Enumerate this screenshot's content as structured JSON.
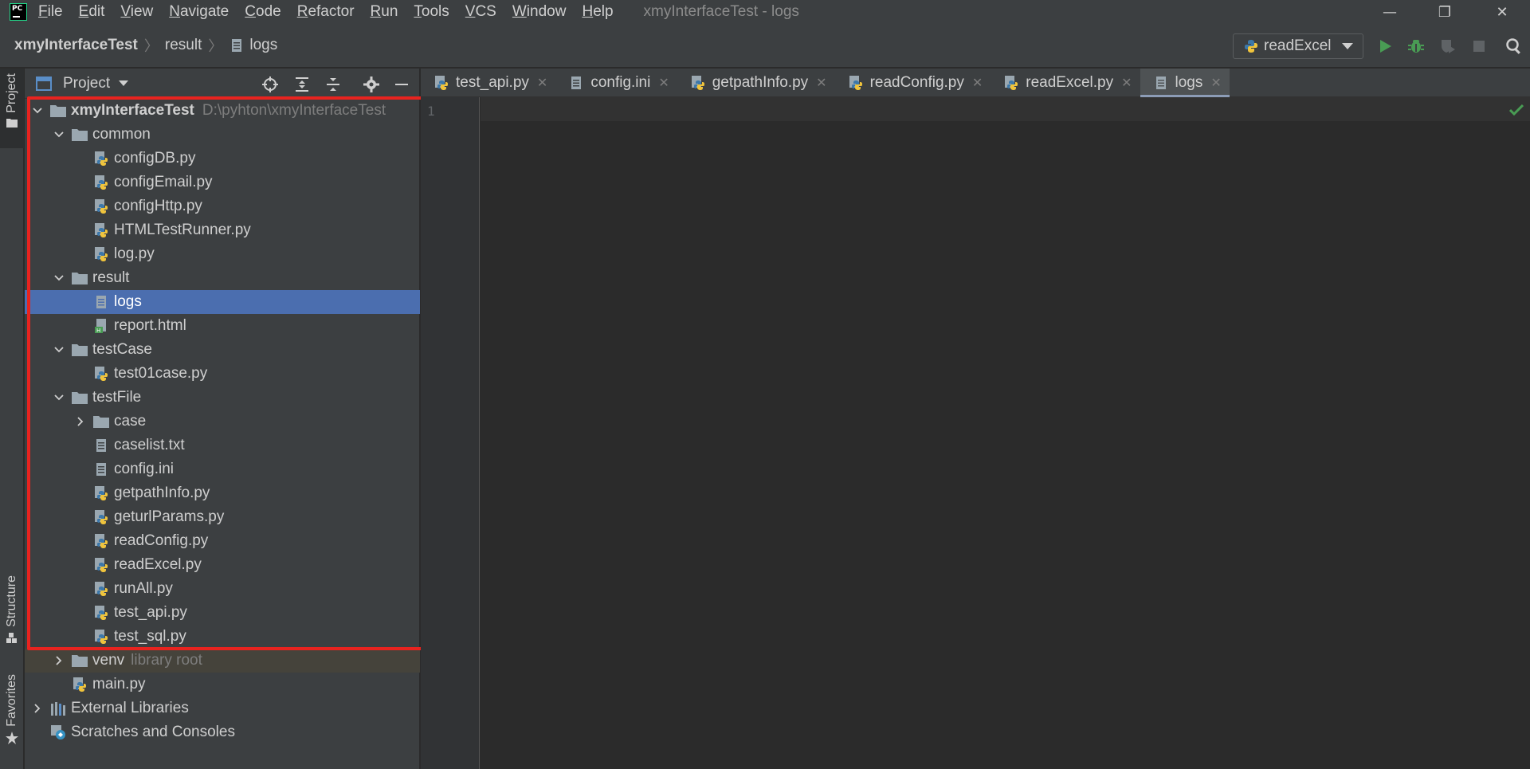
{
  "app": {
    "logo_text": "PC",
    "window_title": "xmyInterfaceTest - logs",
    "window_controls": {
      "minimize": "—",
      "maximize": "❐",
      "close": "✕"
    }
  },
  "menu": [
    "File",
    "Edit",
    "View",
    "Navigate",
    "Code",
    "Refactor",
    "Run",
    "Tools",
    "VCS",
    "Window",
    "Help"
  ],
  "breadcrumb": [
    "xmyInterfaceTest",
    "result",
    "logs"
  ],
  "run_config": {
    "label": "readExcel"
  },
  "left_strip": {
    "project": "Project",
    "structure": "Structure",
    "favorites": "Favorites"
  },
  "project_panel": {
    "title": "Project",
    "tree": [
      {
        "label": "xmyInterfaceTest",
        "hint": "D:\\pyhton\\xmyInterfaceTest"
      },
      {
        "label": "common"
      },
      {
        "label": "configDB.py"
      },
      {
        "label": "configEmail.py"
      },
      {
        "label": "configHttp.py"
      },
      {
        "label": "HTMLTestRunner.py"
      },
      {
        "label": "log.py"
      },
      {
        "label": "result"
      },
      {
        "label": "logs"
      },
      {
        "label": "report.html"
      },
      {
        "label": "testCase"
      },
      {
        "label": "test01case.py"
      },
      {
        "label": "testFile"
      },
      {
        "label": "case"
      },
      {
        "label": "caselist.txt"
      },
      {
        "label": "config.ini"
      },
      {
        "label": "getpathInfo.py"
      },
      {
        "label": "geturlParams.py"
      },
      {
        "label": "readConfig.py"
      },
      {
        "label": "readExcel.py"
      },
      {
        "label": "runAll.py"
      },
      {
        "label": "test_api.py"
      },
      {
        "label": "test_sql.py"
      },
      {
        "label": "venv",
        "hint": "library root"
      },
      {
        "label": "main.py"
      },
      {
        "label": "External Libraries"
      },
      {
        "label": "Scratches and Consoles"
      }
    ]
  },
  "tabs": [
    "test_api.py",
    "config.ini",
    "getpathInfo.py",
    "readConfig.py",
    "readExcel.py",
    "logs"
  ],
  "editor": {
    "line_number": "1"
  },
  "colors": {
    "selection": "#4b6eaf",
    "highlight_box": "#e8231f",
    "run_green": "#499c54",
    "python_blue": "#3c78aa",
    "python_yellow": "#f0c43c"
  }
}
